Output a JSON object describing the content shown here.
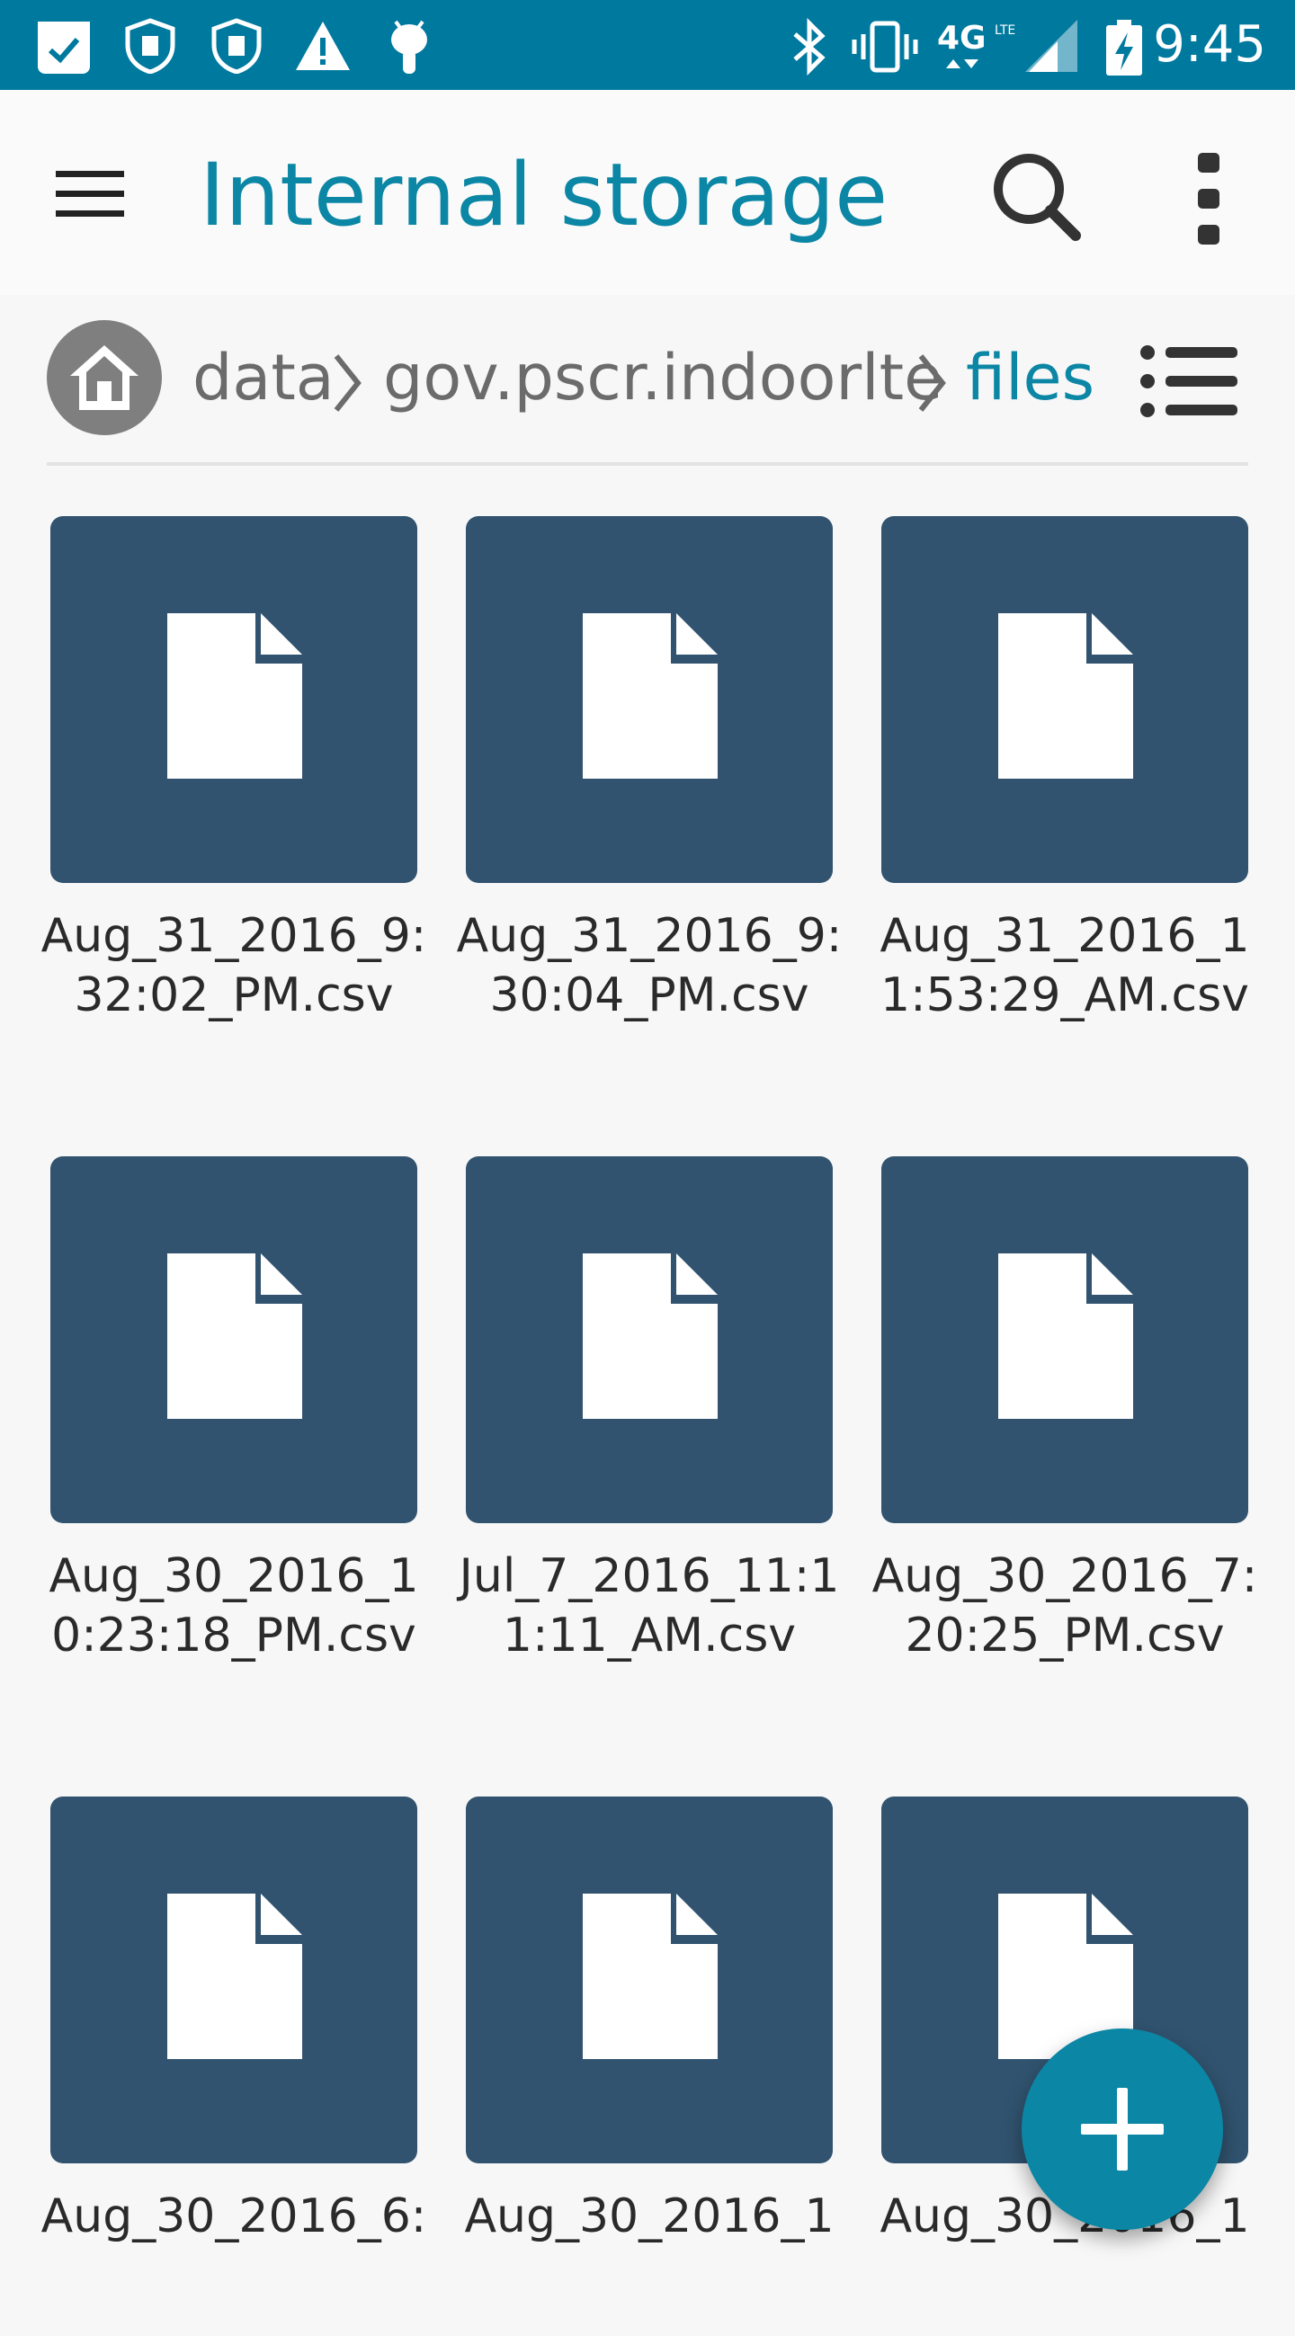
{
  "status_bar": {
    "time": "9:45",
    "network": "4G",
    "icons": [
      "calendar-check-icon",
      "shield-icon",
      "shield-icon",
      "warning-icon",
      "android-icon",
      "bluetooth-icon",
      "vibrate-icon",
      "lte-icon",
      "signal-icon",
      "battery-charging-icon"
    ]
  },
  "toolbar": {
    "title": "Internal storage",
    "menu_icon": "hamburger-menu-icon",
    "search_icon": "search-icon",
    "overflow_icon": "more-vert-icon"
  },
  "breadcrumb": {
    "home_icon": "home-icon",
    "items": [
      "data",
      "gov.pscr.indoorlte",
      "files"
    ],
    "view_toggle_icon": "list-view-icon"
  },
  "files": [
    {
      "name": "Aug_31_2016_9:32:02_PM.csv"
    },
    {
      "name": "Aug_31_2016_9:30:04_PM.csv"
    },
    {
      "name": "Aug_31_2016_11:53:29_AM.csv"
    },
    {
      "name": "Aug_30_2016_10:23:18_PM.csv"
    },
    {
      "name": "Jul_7_2016_11:11:11_AM.csv"
    },
    {
      "name": "Aug_30_2016_7:20:25_PM.csv"
    },
    {
      "name": "Aug_30_2016_6:"
    },
    {
      "name": "Aug_30_2016_1"
    },
    {
      "name": "Aug_30_2016_1"
    }
  ],
  "fab": {
    "icon": "add-icon"
  },
  "colors": {
    "status_bar": "#00799f",
    "accent": "#0b86a5",
    "tile": "#31536f",
    "background": "#f7f7f7"
  }
}
